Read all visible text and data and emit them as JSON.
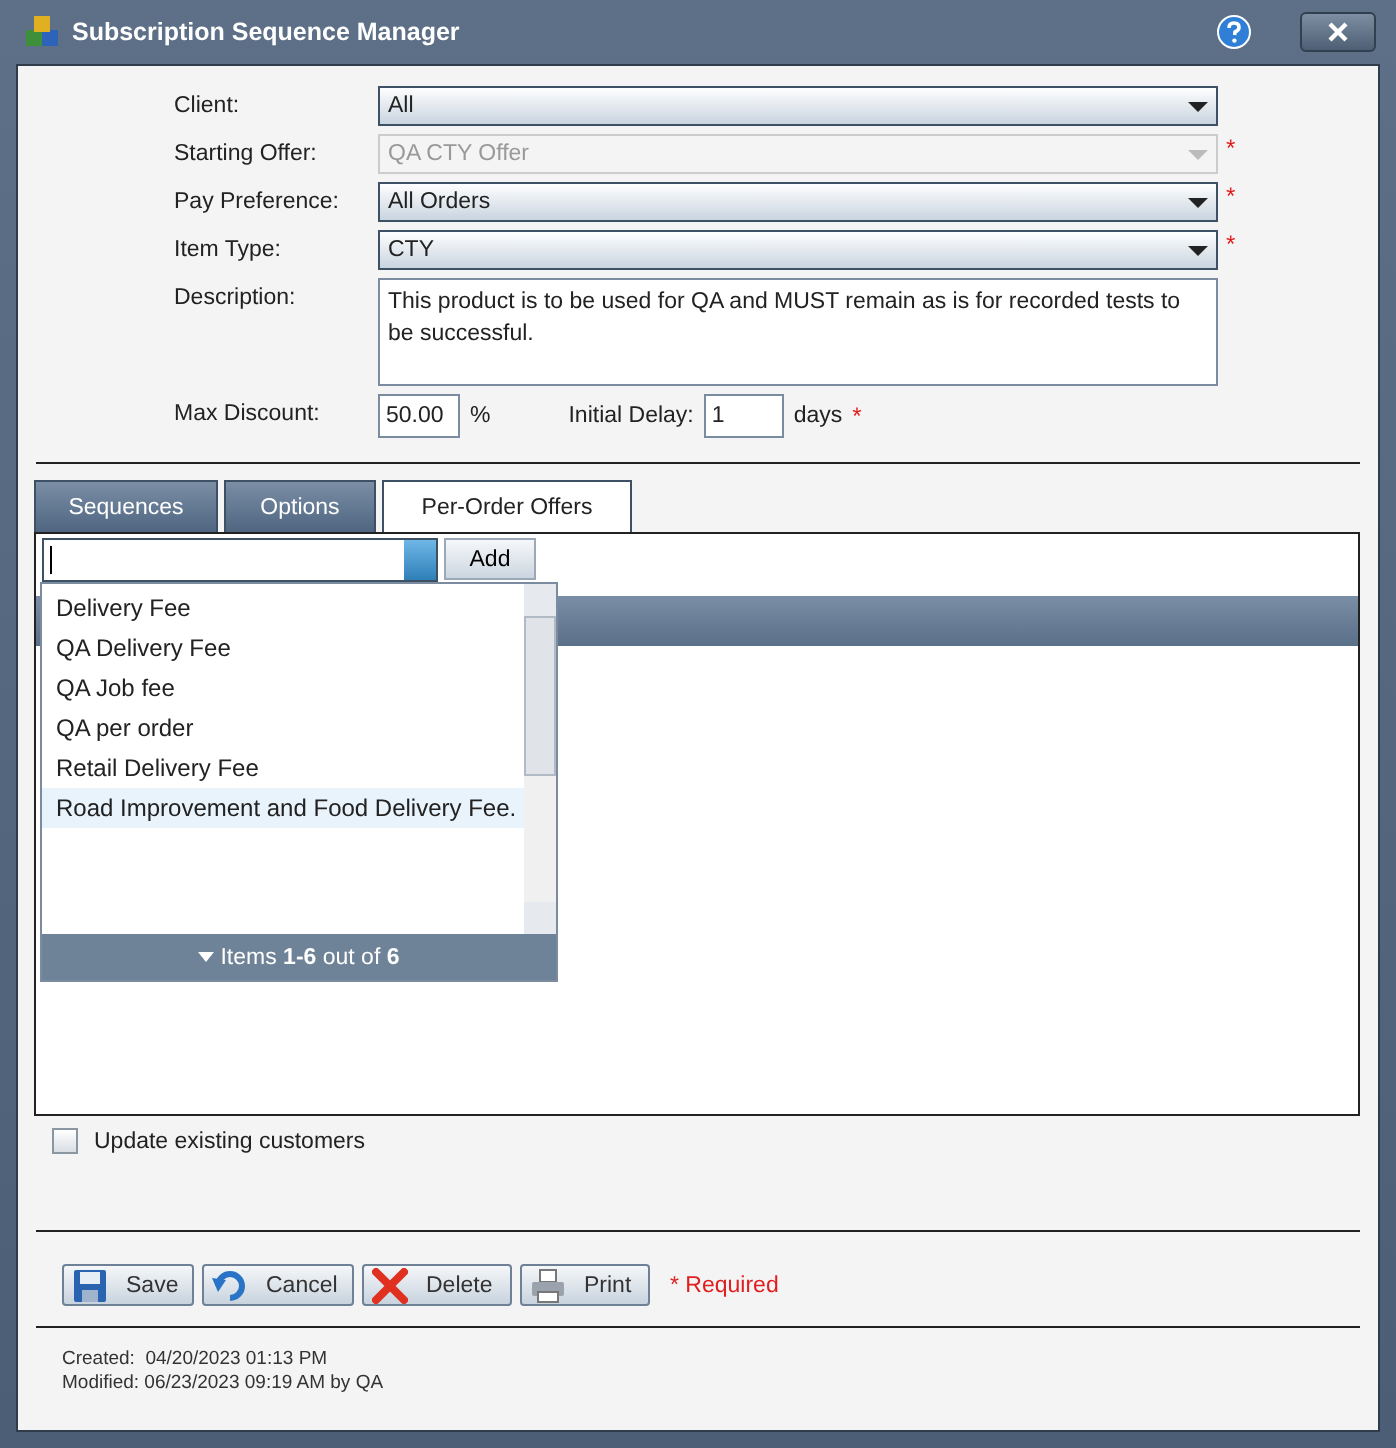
{
  "window": {
    "title": "Subscription Sequence Manager"
  },
  "fields": [
    {
      "label": "Client:",
      "kind": "select",
      "value": "All",
      "disabled": false
    },
    {
      "label": "Starting Offer:",
      "kind": "select",
      "value": "QA CTY Offer",
      "disabled": true,
      "required_mark": "*"
    },
    {
      "label": "Pay Preference:",
      "kind": "select",
      "value": "All Orders",
      "disabled": false,
      "required_mark": "*"
    },
    {
      "label": "Item Type:",
      "kind": "select",
      "value": "CTY",
      "disabled": false,
      "required_mark": "*"
    },
    {
      "label": "Description:",
      "kind": "textarea",
      "value": "This product is to be used for QA and MUST remain as is for recorded tests to be successful.",
      "disabled": false
    }
  ],
  "max_discount": {
    "label": "Max Discount:",
    "value": "50.00",
    "unit": "%"
  },
  "initial_delay": {
    "label": "Initial Delay:",
    "value": "1",
    "unit": "days",
    "required_mark": "*"
  },
  "tabs": [
    {
      "label": "Sequences",
      "selected": false
    },
    {
      "label": "Options",
      "selected": false
    },
    {
      "label": "Per-Order Offers",
      "selected": true
    }
  ],
  "add_button": "Add",
  "dropdown": {
    "items": [
      {
        "label": "Delivery Fee",
        "selected": false
      },
      {
        "label": "QA Delivery Fee",
        "selected": false
      },
      {
        "label": "QA Job fee",
        "selected": false
      },
      {
        "label": "QA per order",
        "selected": false
      },
      {
        "label": "Retail Delivery Fee",
        "selected": false
      },
      {
        "label": "Road Improvement and Food Delivery Fee.",
        "selected": true
      }
    ],
    "footer": "Items **1-6** out of **6**"
  },
  "update_existing": {
    "label": "Update existing customers",
    "checked": false
  },
  "buttons": [
    {
      "kind": "save",
      "label": "Save"
    },
    {
      "kind": "cancel",
      "label": "Cancel"
    },
    {
      "kind": "delete",
      "label": "Delete"
    },
    {
      "kind": "print",
      "label": "Print"
    }
  ],
  "required_note": "* Required",
  "audit": [
    "Created:  04/20/2023 01:13 PM",
    "Modified: 06/23/2023 09:19 AM by QA"
  ]
}
